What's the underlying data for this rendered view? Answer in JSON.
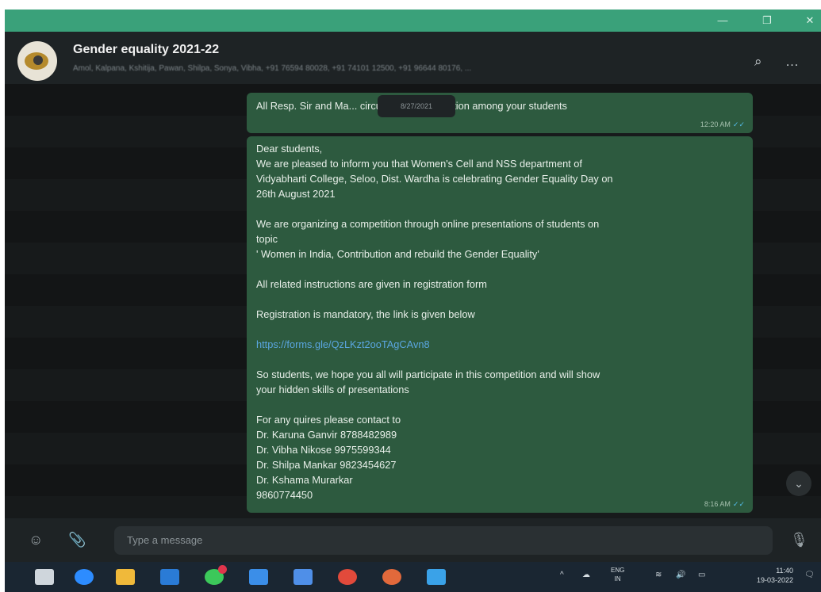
{
  "window": {
    "minimize_glyph": "—",
    "maximize_glyph": "❐",
    "close_glyph": "✕"
  },
  "chat": {
    "title": "Gender equality 2021-22",
    "members": "Amol, Kalpana, Kshitija, Pawan, Shilpa, Sonya, Vibha, +91 76594 80028, +91 74101 12500, +91 96644 80176, ...",
    "search_icon": "search-icon",
    "menu_icon": "more-options-icon",
    "search_glyph": "⌕",
    "menu_glyph": "…"
  },
  "messages": [
    {
      "lines": [
        "All Resp. Sir and Ma... circulate this information among your students"
      ],
      "time": "12:20 AM"
    },
    {
      "lines": [
        "Dear students,",
        "We are pleased to inform you that Women's Cell and NSS department of",
        "Vidyabharti College, Seloo, Dist. Wardha is celebrating Gender Equality Day on",
        "26th August 2021",
        "",
        "We are organizing a competition through online presentations of students on",
        "topic",
        "' Women in India, Contribution and rebuild the Gender Equality'",
        "",
        "All related instructions are given in registration form",
        "",
        "Registration is mandatory, the link is given below",
        "",
        "https://forms.gle/QzLKzt2ooTAgCAvn8",
        "",
        "So students, we hope you all will participate in this competition and will show",
        "your hidden skills of presentations",
        "",
        "For any quires please contact to",
        "Dr. Karuna Ganvir 8788482989",
        "Dr. Vibha Nikose 9975599344",
        "Dr. Shilpa Mankar 9823454627",
        "Dr. Kshama Murarkar",
        "9860774450"
      ],
      "time": "8:16 AM"
    }
  ],
  "date_chip": "8/27/2021",
  "composer": {
    "placeholder": "Type a message",
    "emoji_glyph": "☺",
    "attach_glyph": "📎",
    "mic_glyph": "🎙"
  },
  "taskbar": {
    "lang_top": "ENG",
    "lang_bottom": "IN",
    "time": "11:40",
    "date": "19-03-2022",
    "tray_glyphs": "^",
    "colors": {
      "start": "#cfd6dc",
      "zoom": "#2d8cff",
      "files": "#f0b93a",
      "mail": "#2a7bd6",
      "whatsapp": "#3cc85a",
      "store": "#3b8ee8",
      "dropbox": "#4f8fe8",
      "chrome": "#e24a3b",
      "firefox": "#e2693b",
      "photos": "#3aa2e8"
    }
  }
}
